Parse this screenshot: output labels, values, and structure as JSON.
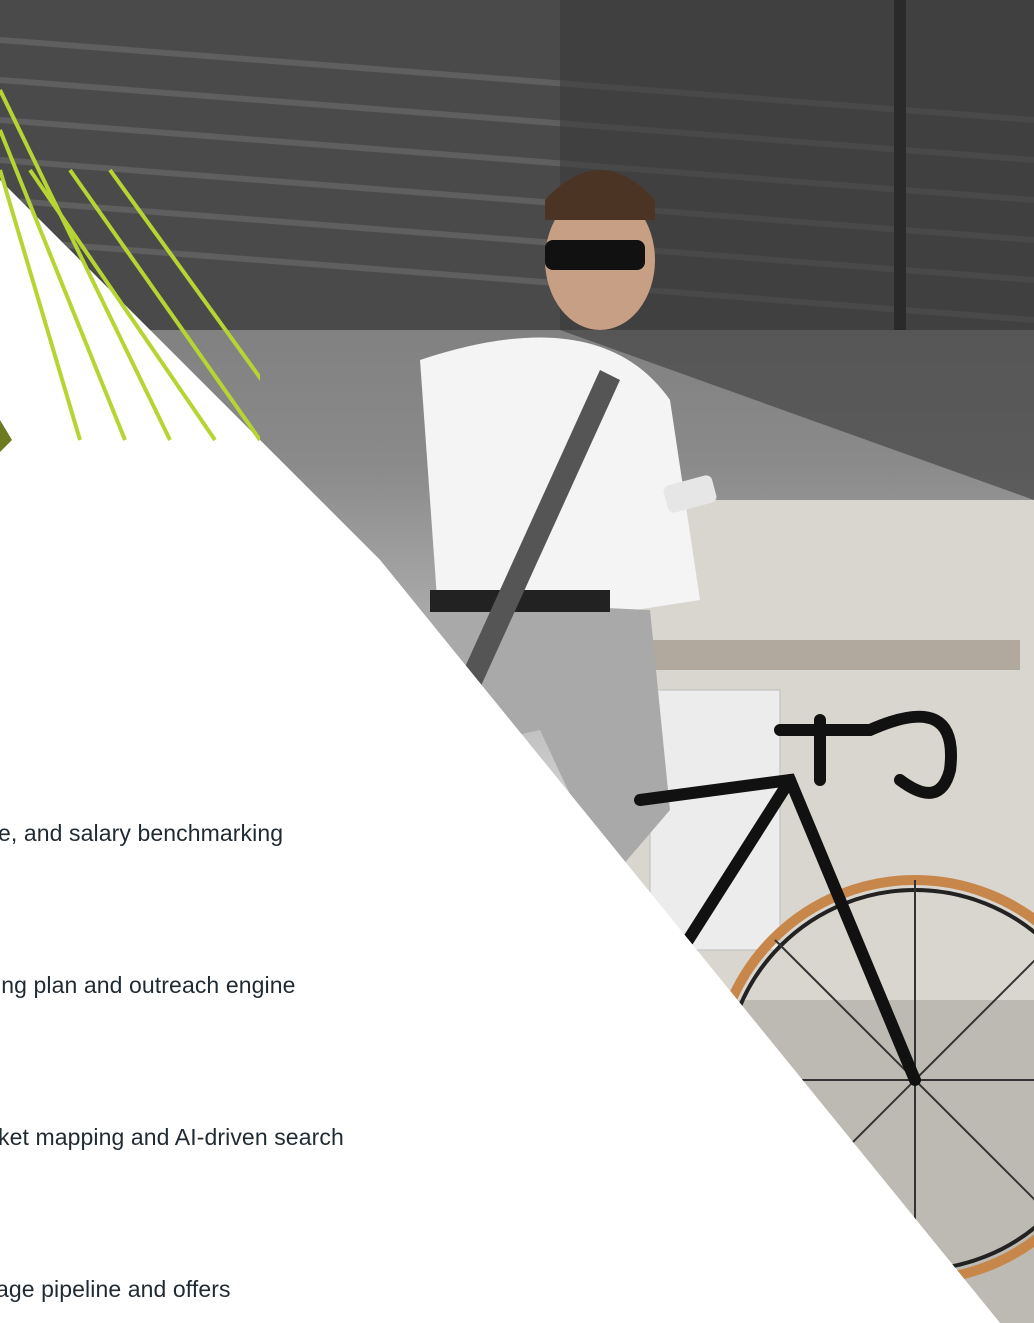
{
  "accent_color": "#b6d532",
  "photo": {
    "subject": "photo-man-with-phone-on-bicycle"
  },
  "services": {
    "items": [
      {
        "text": "e, and salary benchmarking"
      },
      {
        "text": "ing plan and outreach engine"
      },
      {
        "text": "ket mapping and AI-driven search"
      },
      {
        "text": "age pipeline and offers"
      }
    ]
  }
}
